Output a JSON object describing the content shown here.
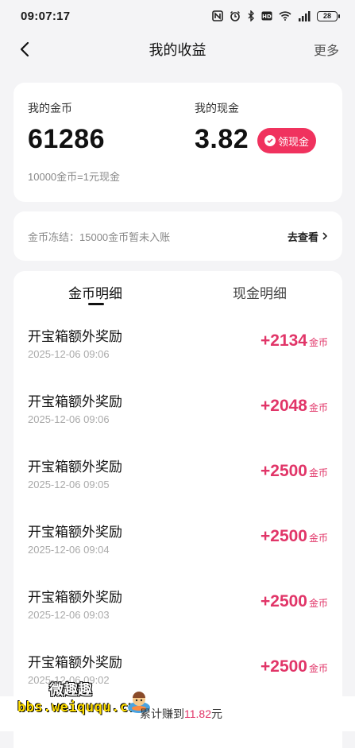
{
  "status_bar": {
    "time": "09:07:17",
    "battery": "28",
    "icons": [
      "nfc-icon",
      "alarm-icon",
      "bluetooth-icon",
      "hd-icon",
      "wifi-icon",
      "signal-icon",
      "battery-icon"
    ]
  },
  "header": {
    "title": "我的收益",
    "more_label": "更多"
  },
  "summary": {
    "coins_label": "我的金币",
    "coins_value": "61286",
    "cash_label": "我的现金",
    "cash_value": "3.82",
    "withdraw_label": "领现金",
    "rate_text": "10000金币=1元现金"
  },
  "freeze": {
    "info_text": "金币冻结：15000金币暂未入账",
    "link_label": "去查看"
  },
  "tabs": [
    {
      "label": "金币明细",
      "active": true
    },
    {
      "label": "现金明细",
      "active": false
    }
  ],
  "records": [
    {
      "title": "开宝箱额外奖励",
      "time": "2025-12-06 09:06",
      "amount": "+2134",
      "unit": "金币"
    },
    {
      "title": "开宝箱额外奖励",
      "time": "2025-12-06 09:06",
      "amount": "+2048",
      "unit": "金币"
    },
    {
      "title": "开宝箱额外奖励",
      "time": "2025-12-06 09:05",
      "amount": "+2500",
      "unit": "金币"
    },
    {
      "title": "开宝箱额外奖励",
      "time": "2025-12-06 09:04",
      "amount": "+2500",
      "unit": "金币"
    },
    {
      "title": "开宝箱额外奖励",
      "time": "2025-12-06 09:03",
      "amount": "+2500",
      "unit": "金币"
    },
    {
      "title": "开宝箱额外奖励",
      "time": "2025-12-06 09:02",
      "amount": "+2500",
      "unit": "金币"
    }
  ],
  "bottom": {
    "earned_prefix": "累计赚到",
    "earned_amount": "11.82",
    "earned_suffix": "元",
    "watermark_brand": "微趣趣",
    "watermark_site": "bbs.weiququ.cn"
  },
  "colors": {
    "accent": "#f0325e",
    "amount": "#e13568",
    "background": "#f4f4f6"
  }
}
